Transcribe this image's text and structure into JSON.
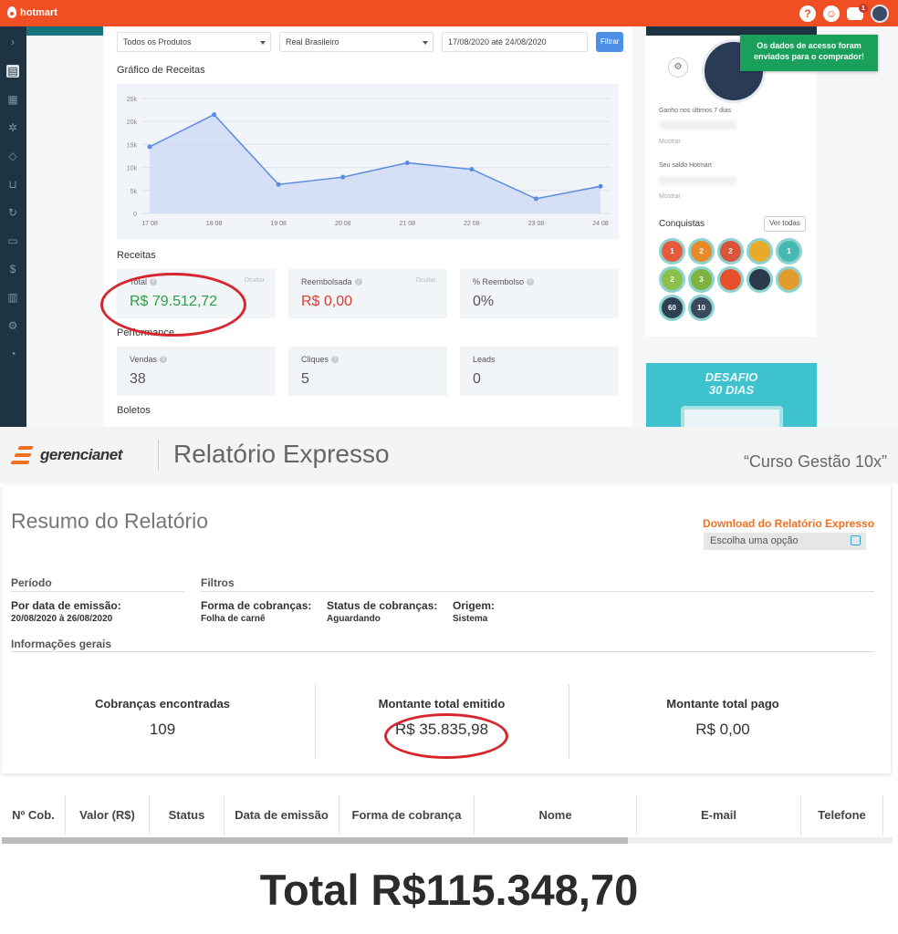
{
  "hotmart": {
    "brand": "hotmart",
    "notif_count": "1",
    "filters": {
      "products": "Todos os Produtos",
      "currency": "Real Brasileiro",
      "date_range": "17/08/2020 até 24/08/2020",
      "filter_button": "Filtrar"
    },
    "chart_title": "Gráfico de Receitas",
    "receitas_title": "Receitas",
    "receitas": [
      {
        "label": "Total",
        "value": "R$ 79.512,72",
        "action": "Ocultar"
      },
      {
        "label": "Reembolsada",
        "value": "R$ 0,00",
        "action": "Ocultar"
      },
      {
        "label": "% Reembolso",
        "value": "0%"
      }
    ],
    "performance_title": "Performance",
    "performance": [
      {
        "label": "Vendas",
        "value": "38"
      },
      {
        "label": "Cliques",
        "value": "5"
      },
      {
        "label": "Leads",
        "value": "0"
      }
    ],
    "boletos_title": "Boletos",
    "sidebar_right": {
      "ganho_label": "Ganho nos últimos 7 dias",
      "saldo_label": "Seu saldo Hotmart",
      "mostrar": "Mostrar",
      "conquistas": "Conquistas",
      "ver_todas": "Ver todas",
      "medals": [
        "1",
        "2",
        "2",
        "",
        "1",
        "2",
        "3",
        "",
        "",
        "",
        "60",
        "10"
      ]
    },
    "toast": "Os dados de acesso foram enviados para o comprador!",
    "banner": {
      "line1": "DESAFIO",
      "line2": "30 DIAS"
    },
    "colors": {
      "orange": "#f04e23",
      "sidebar": "#1f3442",
      "green": "#2e9d45",
      "red": "#e03a2f",
      "toast": "#19a05b"
    }
  },
  "chart_data": {
    "type": "area",
    "title": "Gráfico de Receitas",
    "categories": [
      "17 08",
      "18 08",
      "19 08",
      "20 08",
      "21 08",
      "22 08",
      "23 08",
      "24 08"
    ],
    "values": [
      14500,
      21500,
      6300,
      7900,
      11000,
      9600,
      3200,
      5900
    ],
    "ylim": [
      0,
      25000
    ],
    "yticks": [
      "0",
      "5k",
      "10k",
      "15k",
      "20k",
      "25k"
    ],
    "grid": true,
    "colors": {
      "line": "#5b8be0",
      "fill": "#c9d6f3"
    }
  },
  "gerencianet": {
    "brand": "gerencianet",
    "title": "Relatório Expresso",
    "course": "“Curso Gestão 10x”",
    "resumo": "Resumo do Relatório",
    "download": "Download do Relatório Expresso",
    "choose_option": "Escolha uma opção",
    "periodo": "Período",
    "filtros": "Filtros",
    "por_data_label": "Por data de emissão:",
    "por_data_value": "20/08/2020 à 26/08/2020",
    "forma_label": "Forma de cobranças:",
    "forma_value": "Folha de carnê",
    "status_label": "Status de cobranças:",
    "status_value": "Aguardando",
    "origem_label": "Origem:",
    "origem_value": "Sistema",
    "info_gerais": "Informações gerais",
    "stats": [
      {
        "label": "Cobranças encontradas",
        "value": "109"
      },
      {
        "label": "Montante total emitido",
        "value": "R$ 35.835,98"
      },
      {
        "label": "Montante total pago",
        "value": "R$ 0,00"
      }
    ],
    "table_headers": [
      "Nº Cob.",
      "Valor (R$)",
      "Status",
      "Data de emissão",
      "Forma de cobrança",
      "Nome",
      "E-mail",
      "Telefone"
    ],
    "colors": {
      "orange": "#f37021"
    }
  },
  "total": "Total R$115.348,70"
}
